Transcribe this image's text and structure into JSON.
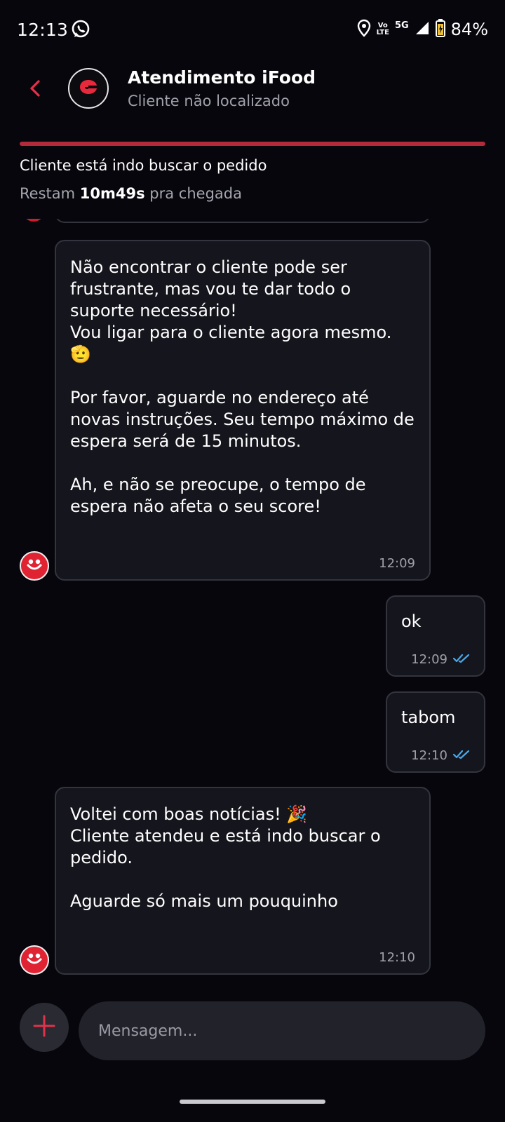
{
  "status_bar": {
    "time": "12:13",
    "volte_top": "Vo",
    "volte_bottom": "LTE",
    "network": "5G",
    "battery": "84%",
    "icons": [
      "whatsapp-icon",
      "location-icon",
      "signal-icon",
      "battery-icon"
    ]
  },
  "header": {
    "title": "Atendimento iFood",
    "subtitle": "Cliente não localizado"
  },
  "order_status": {
    "progress": 1.0,
    "text": "Cliente está indo buscar o pedido",
    "remaining_prefix": "Restam",
    "remaining_time": "10m49s",
    "remaining_suffix": "pra chegada"
  },
  "messages": [
    {
      "direction": "incoming",
      "text": "Não encontrar o cliente pode ser frustrante, mas vou te dar todo o suporte necessário!\nVou ligar para o cliente agora mesmo. 🫡\n\nPor favor, aguarde no endereço até novas instruções. Seu tempo máximo de espera será de 15 minutos.\n\nAh, e não se preocupe, o tempo de espera não afeta o seu score!",
      "time": "12:09"
    },
    {
      "direction": "outgoing",
      "text": "ok",
      "time": "12:09",
      "read": true
    },
    {
      "direction": "outgoing",
      "text": "tabom",
      "time": "12:10",
      "read": true
    },
    {
      "direction": "incoming",
      "text": "Voltei com boas notícias! 🎉\nCliente atendeu e está indo buscar o pedido.\n\nAguarde só mais um pouquinho",
      "time": "12:10"
    }
  ],
  "composer": {
    "placeholder": "Mensagem..."
  },
  "colors": {
    "background": "#06060c",
    "accent_red": "#e02333",
    "bubble": "#15151d",
    "read_check": "#4aa8e8"
  }
}
